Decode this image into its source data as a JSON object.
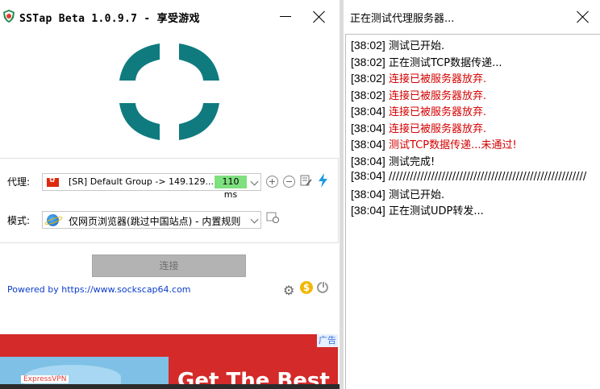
{
  "left_window": {
    "title": "SSTap Beta 1.0.9.7 - 享受游戏",
    "proxy": {
      "label": "代理:",
      "selected": "[SR] Default Group -> 149.129....",
      "ping": "110 ms"
    },
    "mode": {
      "label": "模式:",
      "selected": "仅网页浏览器(跳过中国站点) - 内置规则"
    },
    "connect_label": "连接",
    "powered_by": "Powered by https://www.sockscap64.com",
    "ad": {
      "badge": "广告",
      "logo": "ExpressVPN",
      "headline": "Get The Best"
    },
    "accent_color": "#0f7b7f"
  },
  "right_window": {
    "title": "正在测试代理服务器...",
    "log": [
      {
        "time": "[38:02]",
        "msg": "测试已开始.",
        "error": false
      },
      {
        "time": "[38:02]",
        "msg": "正在测试TCP数据传递...",
        "error": false
      },
      {
        "time": "[38:02]",
        "msg": "连接已被服务器放弃.",
        "error": true
      },
      {
        "time": "[38:02]",
        "msg": "连接已被服务器放弃.",
        "error": true
      },
      {
        "time": "[38:04]",
        "msg": "连接已被服务器放弃.",
        "error": true
      },
      {
        "time": "[38:04]",
        "msg": "连接已被服务器放弃.",
        "error": true
      },
      {
        "time": "[38:04]",
        "msg": "测试TCP数据传递...未通过!",
        "error": true
      },
      {
        "time": "[38:04]",
        "msg": "测试完成!",
        "error": false
      },
      {
        "time": "[38:04]",
        "msg": "////////////////////////////////////////////////////////",
        "error": false
      },
      {
        "time": "[38:04]",
        "msg": "测试已开始.",
        "error": false
      },
      {
        "time": "[38:04]",
        "msg": "正在测试UDP转发...",
        "error": false
      }
    ]
  }
}
